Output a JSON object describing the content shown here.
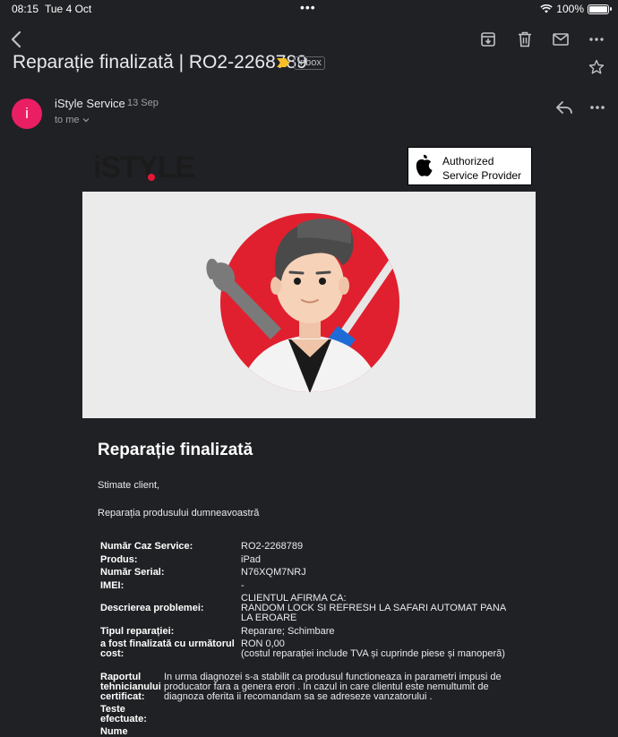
{
  "status_bar": {
    "time": "08:15",
    "date": "Tue 4 Oct",
    "battery": "100%"
  },
  "email": {
    "subject": "Reparație finalizată | RO2-2268789",
    "label": "Inbox",
    "sender_initial": "i",
    "sender_name": "iStyle Service",
    "sent_date": "13 Sep",
    "recipient": "to me"
  },
  "header_logos": {
    "brand": "iSTYLE",
    "badge_line1": "Authorized",
    "badge_line2": "Service Provider"
  },
  "body": {
    "heading": "Reparație finalizată",
    "greeting": "Stimate client,",
    "intro": "Reparația produsului dumneavoastră"
  },
  "details": {
    "case_label": "Număr Caz Service:",
    "case_value": "RO2-2268789",
    "product_label": "Produs:",
    "product_value": "iPad",
    "serial_label": "Număr Serial:",
    "serial_value": "N76XQM7NRJ",
    "imei_label": "IMEI:",
    "imei_value": "-",
    "problem_label": "Descrierea problemei:",
    "problem_line1": "CLIENTUL AFIRMA CA:",
    "problem_line2": "RANDOM LOCK SI REFRESH LA SAFARI AUTOMAT PANA",
    "problem_line3": "LA EROARE",
    "repair_type_label": "Tipul reparației:",
    "repair_type_value": "Reparare; Schimbare",
    "cost_label_line1": "a fost finalizată cu următorul",
    "cost_label_line2": "cost:",
    "cost_value": "RON 0,00",
    "cost_note": "(costul reparației include TVA și cuprinde piese și manoperă)",
    "tech_label_line1": "Raportul",
    "tech_label_line2": "tehnicianului",
    "tech_label_line3": "certificat:",
    "tech_line1": "In urma diagnozei s-a stabilit ca produsul functioneaza in parametri impusi de",
    "tech_line2": "producator fara a genera erori . In cazul in care clientul este nemultumit de",
    "tech_line3": "diagnoza oferita ii recomandam sa se adreseze vanzatorului .",
    "tests_label_line1": "Teste",
    "tests_label_line2": "efectuate:",
    "name_label": "Nume"
  },
  "colors": {
    "background": "#202124",
    "avatar": "#e91e63",
    "brand_red": "#e31837",
    "important_marker": "#f6bf26"
  }
}
